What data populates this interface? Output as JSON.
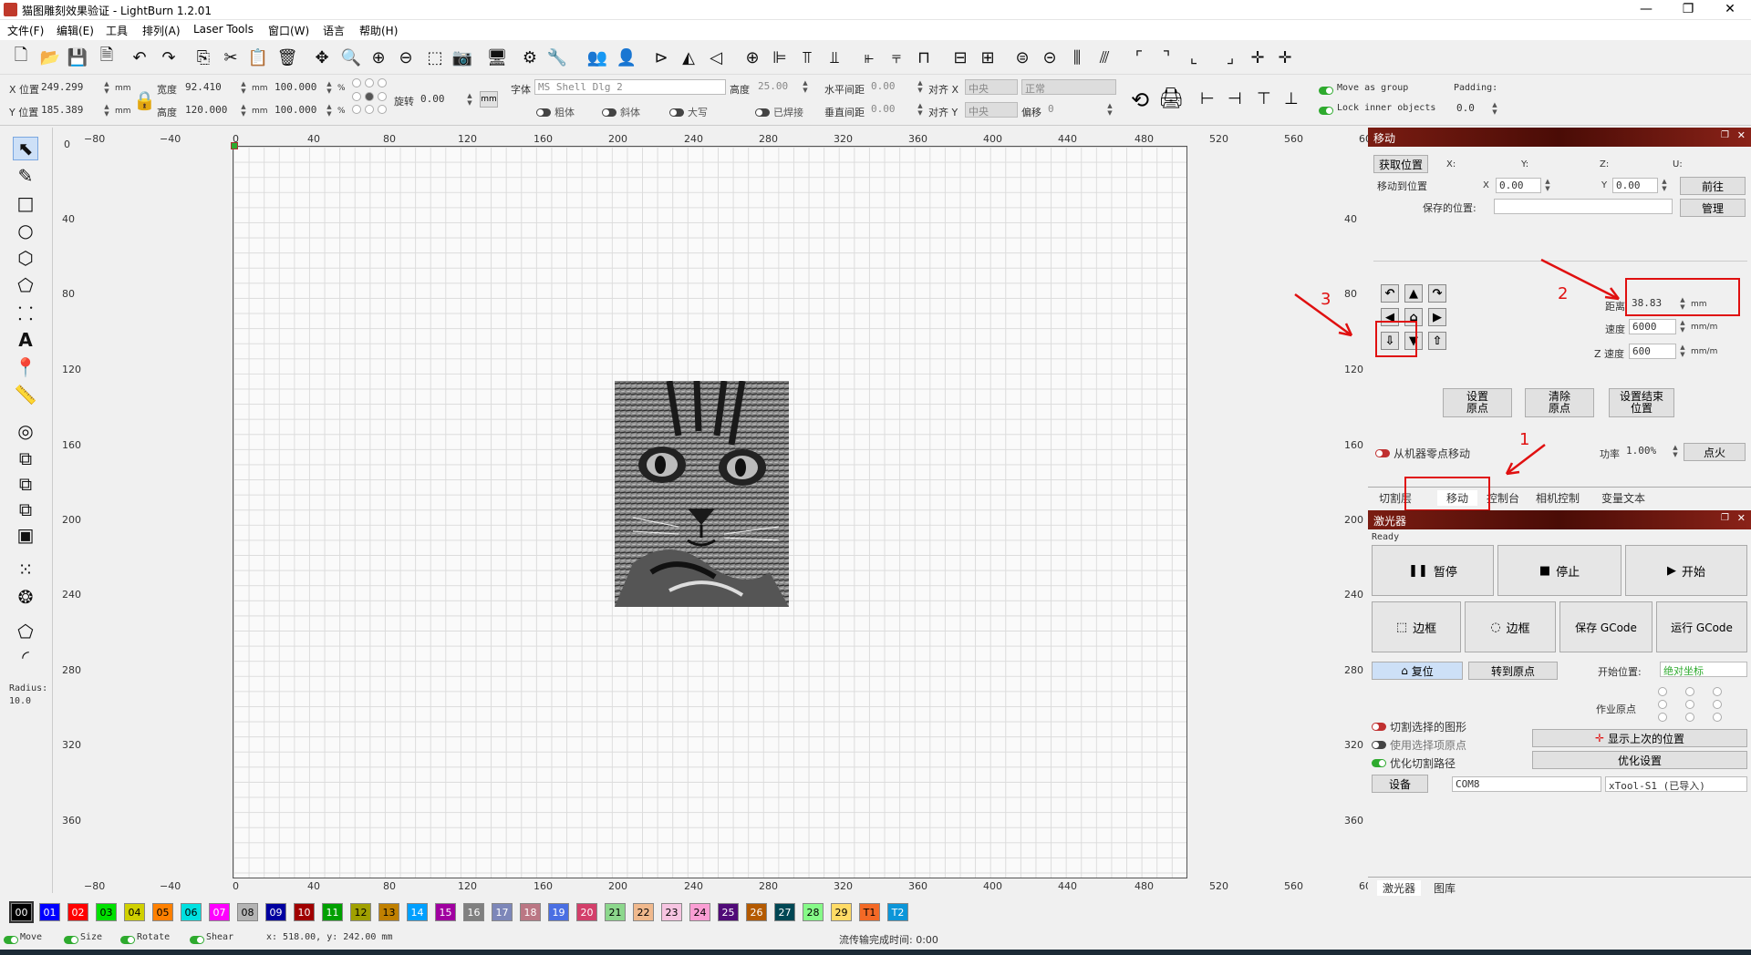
{
  "window": {
    "title": "猫图雕刻效果验证 - LightBurn 1.2.01",
    "minimize": "—",
    "maximize": "❐",
    "close": "✕"
  },
  "menu": [
    "文件(F)",
    "编辑(E)",
    "工具",
    "排列(A)",
    "Laser Tools",
    "窗口(W)",
    "语言",
    "帮助(H)"
  ],
  "props": {
    "x_label": "X 位置",
    "x_value": "249.299",
    "y_label": "Y 位置",
    "y_value": "185.389",
    "unit_mm": "mm",
    "width_label": "宽度",
    "width_value": "92.410",
    "height_label": "高度",
    "height_value": "120.000",
    "pct_w": "100.000",
    "pct_h": "100.000",
    "pct": "%",
    "rotate_label": "旋转",
    "rotate_value": "0.00",
    "mm_btn": "mm"
  },
  "text": {
    "font_label": "字体",
    "font_value": "MS Shell Dlg 2",
    "height_label": "高度",
    "height_value": "25.00",
    "hspace_label": "水平间距",
    "hspace_value": "0.00",
    "vspace_label": "垂直间距",
    "vspace_value": "0.00",
    "align_x_label": "对齐 X",
    "align_x_value": "中央",
    "align_y_label": "对齐 Y",
    "align_y_value": "中央",
    "mode_value": "正常",
    "offset_label": "偏移",
    "offset_value": "0",
    "bold": "粗体",
    "italic": "斜体",
    "upper": "大写",
    "welded": "已焊接"
  },
  "group": {
    "move_as_group": "Move as group",
    "lock_inner": "Lock inner objects",
    "padding_label": "Padding:",
    "padding_value": "0.0"
  },
  "ruler": {
    "top": [
      "−80",
      "−40",
      "0",
      "40",
      "80",
      "120",
      "160",
      "200",
      "240",
      "280",
      "320",
      "360",
      "400",
      "440",
      "480",
      "520",
      "560",
      "60"
    ],
    "left": [
      "0",
      "40",
      "80",
      "120",
      "160",
      "200",
      "240",
      "280",
      "320",
      "360"
    ],
    "right": [
      "40",
      "80",
      "120",
      "160",
      "200",
      "240",
      "280",
      "320",
      "360"
    ]
  },
  "left_tools": {
    "radius_label": "Radius:",
    "radius_value": "10.0"
  },
  "move_panel": {
    "title": "移动",
    "get_pos": "获取位置",
    "x_col": "X:",
    "y_col": "Y:",
    "z_col": "Z:",
    "u_col": "U:",
    "move_to": "移动到位置",
    "x_lbl": "X",
    "x_val": "0.00",
    "y_lbl": "Y",
    "y_val": "0.00",
    "go": "前往",
    "saved_pos": "保存的位置:",
    "manage": "管理",
    "distance_label": "距离",
    "distance_value": "38.83",
    "distance_unit": "mm",
    "speed_label": "速度",
    "speed_value": "6000",
    "speed_unit": "mm/m",
    "zspeed_label": "Z 速度",
    "zspeed_value": "600",
    "zspeed_unit": "mm/m",
    "set_origin": "设置\n原点",
    "clear_origin": "清除\n原点",
    "set_finish": "设置结束\n位置",
    "from_machine_zero": "从机器零点移动",
    "power_label": "功率",
    "power_value": "1.00%",
    "fire": "点火",
    "annot1": "1",
    "annot2": "2",
    "annot3": "3"
  },
  "tabs": [
    "切割层",
    "移动",
    "控制台",
    "相机控制",
    "变量文本"
  ],
  "laser_panel": {
    "title": "激光器",
    "status": "Ready",
    "pause": "暂停",
    "stop": "停止",
    "start": "开始",
    "frame1": "边框",
    "frame2": "边框",
    "save_gcode": "保存 GCode",
    "run_gcode": "运行 GCode",
    "home": "复位",
    "goto_origin": "转到原点",
    "start_from_label": "开始位置:",
    "start_from_value": "绝对坐标",
    "job_origin": "作业原点",
    "cut_selected": "切割选择的图形",
    "use_sel_origin": "使用选择项原点",
    "optimize_path": "优化切割路径",
    "show_last": "显示上次的位置",
    "optimize_settings": "优化设置",
    "devices": "设备",
    "port": "COM8",
    "device": "xTool-S1 (已导入)"
  },
  "bottom_tabs": [
    "激光器",
    "图库"
  ],
  "palette": [
    {
      "id": "00",
      "c": "#000000",
      "t": "#ffffff"
    },
    {
      "id": "01",
      "c": "#0000ff",
      "t": "#ffffff"
    },
    {
      "id": "02",
      "c": "#ff0000",
      "t": "#ffffff"
    },
    {
      "id": "03",
      "c": "#00e000",
      "t": "#000000"
    },
    {
      "id": "04",
      "c": "#d0d000",
      "t": "#000000"
    },
    {
      "id": "05",
      "c": "#ff8000",
      "t": "#000000"
    },
    {
      "id": "06",
      "c": "#00e0e0",
      "t": "#000000"
    },
    {
      "id": "07",
      "c": "#ff00ff",
      "t": "#ffffff"
    },
    {
      "id": "08",
      "c": "#b4b4b4",
      "t": "#000000"
    },
    {
      "id": "09",
      "c": "#0000a0",
      "t": "#ffffff"
    },
    {
      "id": "10",
      "c": "#a00000",
      "t": "#ffffff"
    },
    {
      "id": "11",
      "c": "#00a000",
      "t": "#ffffff"
    },
    {
      "id": "12",
      "c": "#a0a000",
      "t": "#000000"
    },
    {
      "id": "13",
      "c": "#c08000",
      "t": "#000000"
    },
    {
      "id": "14",
      "c": "#00a0ff",
      "t": "#ffffff"
    },
    {
      "id": "15",
      "c": "#a000a0",
      "t": "#ffffff"
    },
    {
      "id": "16",
      "c": "#808080",
      "t": "#ffffff"
    },
    {
      "id": "17",
      "c": "#7d87b9",
      "t": "#ffffff"
    },
    {
      "id": "18",
      "c": "#bb7784",
      "t": "#ffffff"
    },
    {
      "id": "19",
      "c": "#4a6fe3",
      "t": "#ffffff"
    },
    {
      "id": "20",
      "c": "#d33f6a",
      "t": "#ffffff"
    },
    {
      "id": "21",
      "c": "#8cd78c",
      "t": "#000000"
    },
    {
      "id": "22",
      "c": "#f0b98d",
      "t": "#000000"
    },
    {
      "id": "23",
      "c": "#f6c4e1",
      "t": "#000000"
    },
    {
      "id": "24",
      "c": "#fa9ed4",
      "t": "#000000"
    },
    {
      "id": "25",
      "c": "#500a78",
      "t": "#ffffff"
    },
    {
      "id": "26",
      "c": "#b45a00",
      "t": "#ffffff"
    },
    {
      "id": "27",
      "c": "#004754",
      "t": "#ffffff"
    },
    {
      "id": "28",
      "c": "#86fa88",
      "t": "#000000"
    },
    {
      "id": "29",
      "c": "#ffdb66",
      "t": "#000000"
    },
    {
      "id": "T1",
      "c": "#f36926",
      "t": "#000000"
    },
    {
      "id": "T2",
      "c": "#0c96d9",
      "t": "#ffffff"
    }
  ],
  "status": {
    "move": "Move",
    "size": "Size",
    "rotate": "Rotate",
    "shear": "Shear",
    "coords": "x: 518.00, y: 242.00 mm",
    "stream": "流传输完成时间: 0:00"
  }
}
